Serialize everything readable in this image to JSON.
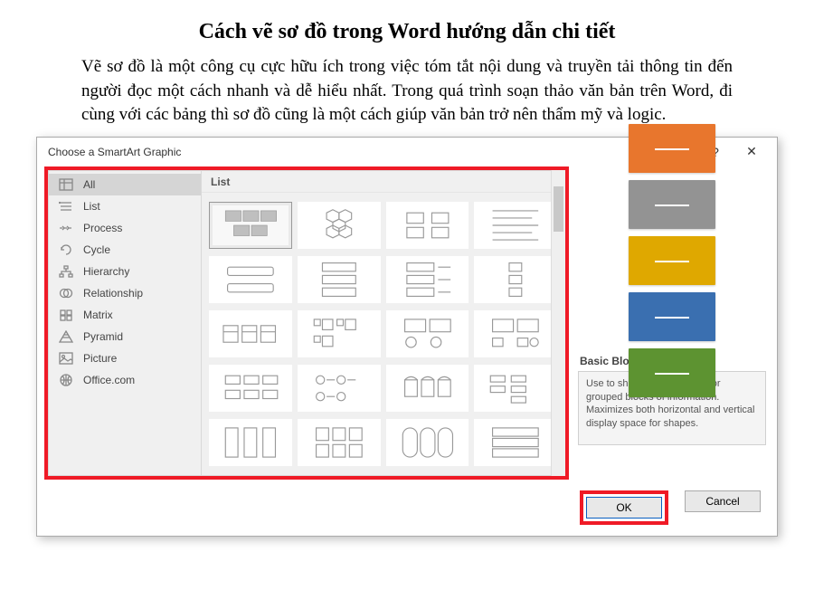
{
  "article": {
    "title": "Cách vẽ sơ đồ trong Word hướng dẫn chi tiết",
    "body": "Vẽ sơ đồ là một công cụ cực hữu ích trong việc tóm tắt nội dung và truyền tải thông tin đến người đọc một cách nhanh và dễ hiểu nhất. Trong quá trình soạn thảo văn bản trên Word, đi cùng với các bảng thì sơ đồ cũng là một cách giúp văn bản trở nên thẩm mỹ và logic."
  },
  "dialog": {
    "title": "Choose a SmartArt Graphic",
    "help": "?",
    "close": "✕",
    "categories": [
      {
        "label": "All",
        "icon": "all",
        "selected": true
      },
      {
        "label": "List",
        "icon": "list",
        "selected": false
      },
      {
        "label": "Process",
        "icon": "process",
        "selected": false
      },
      {
        "label": "Cycle",
        "icon": "cycle",
        "selected": false
      },
      {
        "label": "Hierarchy",
        "icon": "hierarchy",
        "selected": false
      },
      {
        "label": "Relationship",
        "icon": "relation",
        "selected": false
      },
      {
        "label": "Matrix",
        "icon": "matrix",
        "selected": false
      },
      {
        "label": "Pyramid",
        "icon": "pyramid",
        "selected": false
      },
      {
        "label": "Picture",
        "icon": "picture",
        "selected": false
      },
      {
        "label": "Office.com",
        "icon": "officecom",
        "selected": false
      }
    ],
    "gallery_header": "List",
    "preview": {
      "name": "Basic Block List",
      "description": "Use to show non-sequential or grouped blocks of information. Maximizes both horizontal and vertical display space for shapes.",
      "blocks": [
        "orange",
        "gray",
        "gold",
        "blue",
        "green"
      ]
    },
    "buttons": {
      "ok": "OK",
      "cancel": "Cancel"
    }
  }
}
